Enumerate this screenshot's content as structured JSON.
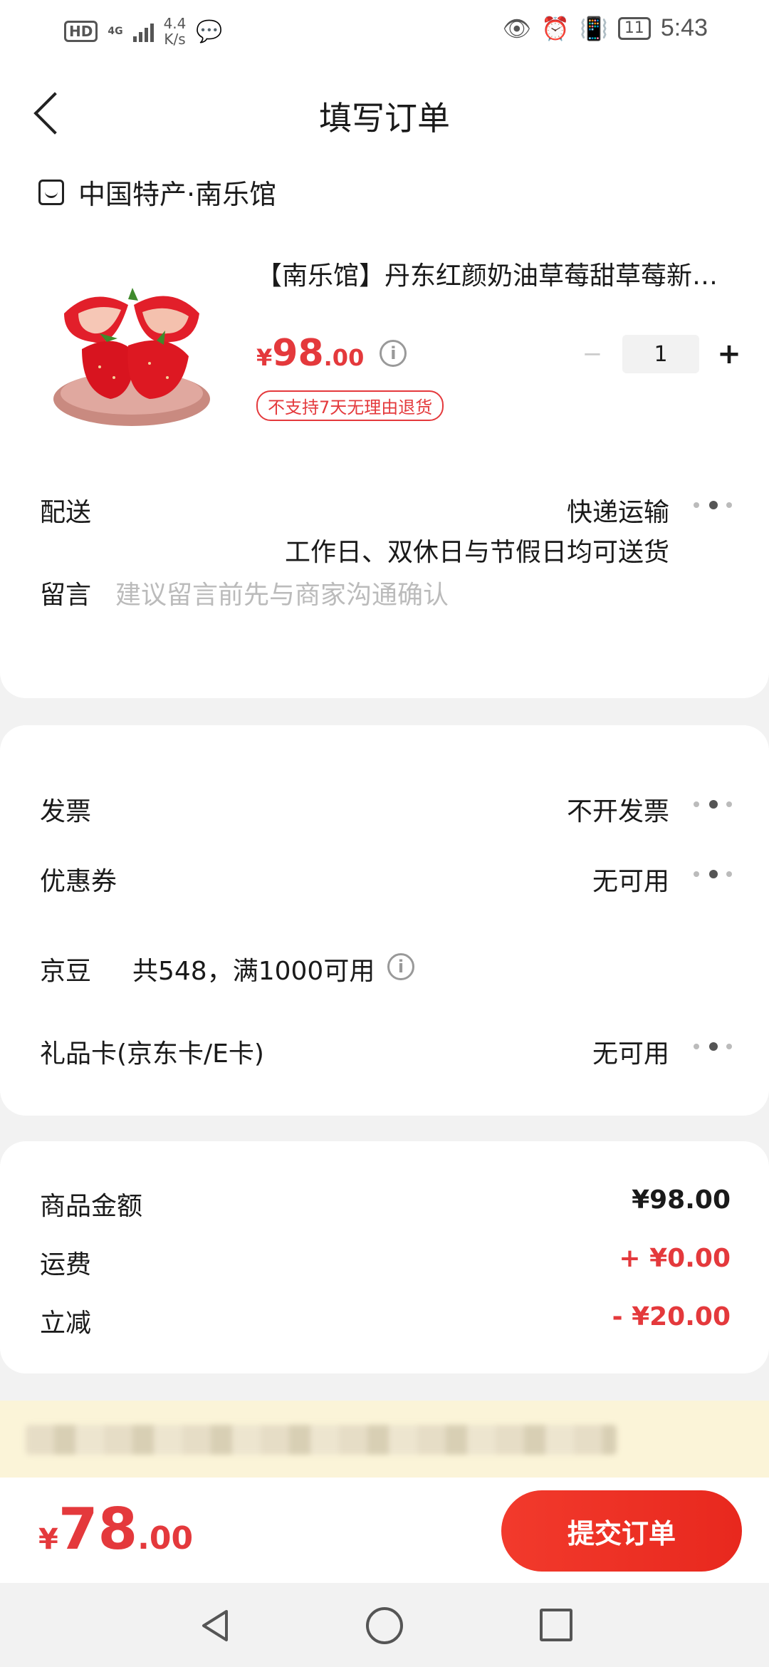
{
  "status_bar": {
    "network_badge": "HD",
    "network_type": "4G",
    "speed_value": "4.4",
    "speed_unit": "K/s",
    "battery": "11",
    "time": "5:43"
  },
  "header": {
    "title": "填写订单"
  },
  "shop": {
    "name": "中国特产·南乐馆"
  },
  "product": {
    "title": "【南乐馆】丹东红颜奶油草莓甜草莓新鲜水果",
    "price_symbol": "¥",
    "price_int": "98",
    "price_dec": ".00",
    "badge": "不支持7天无理由退货",
    "quantity": "1"
  },
  "delivery": {
    "label": "配送",
    "method": "快递运输",
    "note": "工作日、双休日与节假日均可送货"
  },
  "message": {
    "label": "留言",
    "placeholder": "建议留言前先与商家沟通确认"
  },
  "options": {
    "invoice_label": "发票",
    "invoice_value": "不开发票",
    "coupon_label": "优惠券",
    "coupon_value": "无可用",
    "beans_label": "京豆",
    "beans_value": "共548，满1000可用",
    "giftcard_label": "礼品卡(京东卡/E卡)",
    "giftcard_value": "无可用"
  },
  "summary": {
    "goods_label": "商品金额",
    "goods_value": "¥98.00",
    "shipping_label": "运费",
    "shipping_value": "+ ¥0.00",
    "discount_label": "立减",
    "discount_value": "- ¥20.00"
  },
  "footer": {
    "total_symbol": "¥",
    "total_int": "78",
    "total_dec": ".00",
    "submit_label": "提交订单"
  },
  "colors": {
    "accent": "#e4393c",
    "notice_bg": "#fbf4d8"
  }
}
